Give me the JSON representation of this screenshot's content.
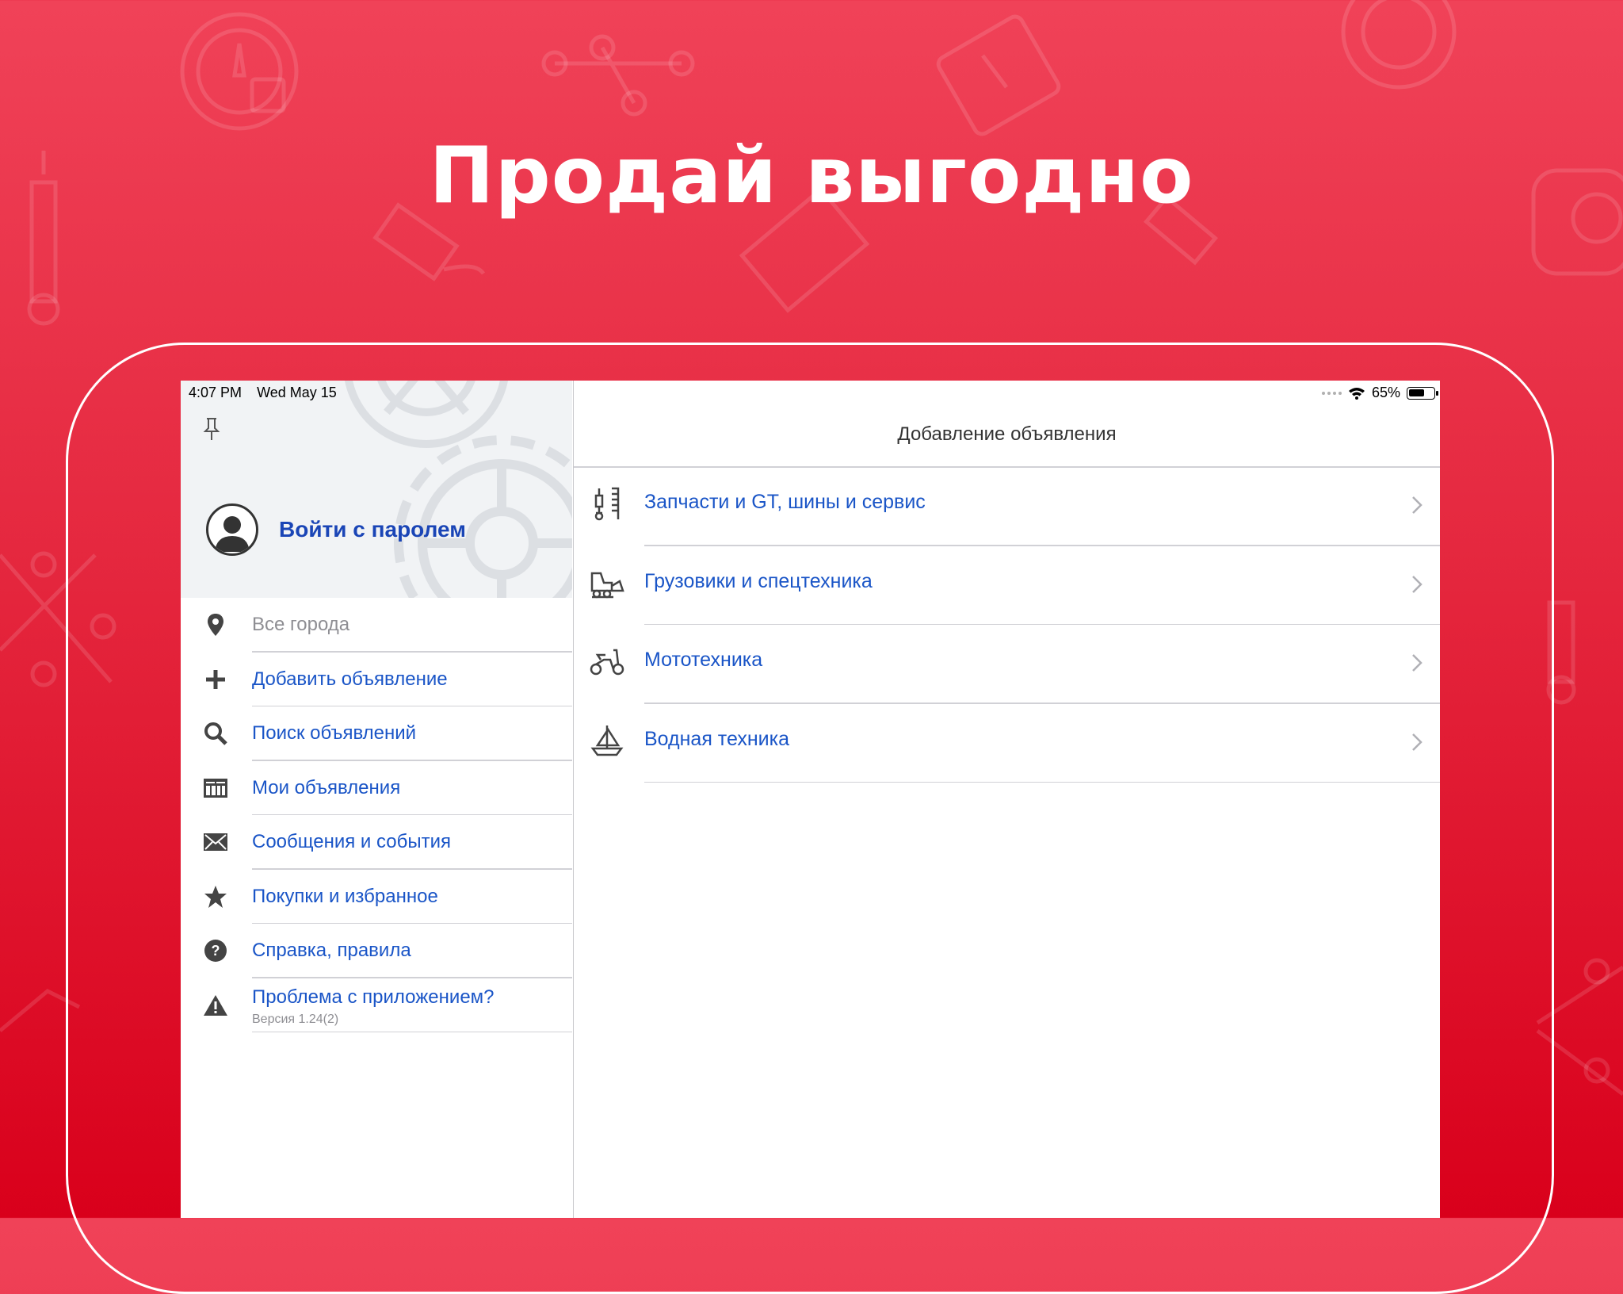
{
  "headline": "Продай выгодно",
  "status_bar": {
    "time": "4:07 PM",
    "date": "Wed May 15",
    "battery_percent": "65%",
    "battery_level": 0.65
  },
  "sidebar": {
    "login_label": "Войти с паролем",
    "items": [
      {
        "label": "Все города",
        "icon": "location-pin-icon"
      },
      {
        "label": "Добавить объявление",
        "icon": "plus-icon"
      },
      {
        "label": "Поиск объявлений",
        "icon": "search-icon"
      },
      {
        "label": "Мои объявления",
        "icon": "listings-icon"
      },
      {
        "label": "Сообщения и события",
        "icon": "envelope-icon"
      },
      {
        "label": "Покупки и избранное",
        "icon": "star-icon"
      },
      {
        "label": "Справка, правила",
        "icon": "question-icon"
      },
      {
        "label": "Проблема с приложением?",
        "sub": "Версия 1.24(2)",
        "icon": "warning-icon"
      }
    ]
  },
  "main": {
    "title": "Добавление объявления",
    "categories": [
      {
        "label": "Запчасти и GT, шины и сервис",
        "icon": "parts-icon"
      },
      {
        "label": "Грузовики и спецтехника",
        "icon": "truck-icon"
      },
      {
        "label": "Мототехника",
        "icon": "scooter-icon"
      },
      {
        "label": "Водная техника",
        "icon": "sailboat-icon"
      }
    ]
  },
  "colors": {
    "accent_blue": "#1a55c7",
    "brand_red": "#e5283f"
  }
}
